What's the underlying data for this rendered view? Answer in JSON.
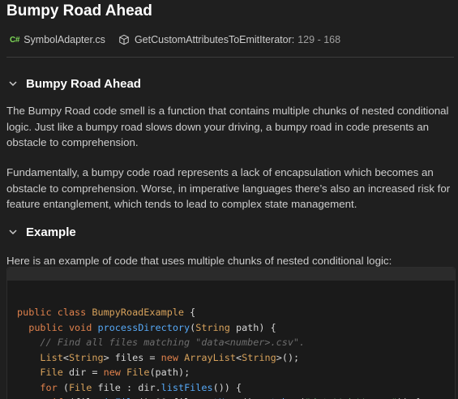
{
  "header": {
    "title": "Bumpy Road Ahead",
    "file_icon_text": "C#",
    "file_name": "SymbolAdapter.cs",
    "method_name": "GetCustomAttributesToEmitIterator:",
    "line_range": "129 - 168"
  },
  "sections": [
    {
      "heading": "Bumpy Road Ahead",
      "paragraphs": [
        "The Bumpy Road code smell is a function that contains multiple chunks of nested conditional logic. Just like a bumpy road slows down your driving, a bumpy road in code presents an obstacle to comprehension.",
        "Fundamentally, a bumpy code road represents a lack of encapsulation which becomes an obstacle to comprehension. Worse, in imperative languages there’s also an increased risk for feature entanglement, which tends to lead to complex state management."
      ]
    },
    {
      "heading": "Example",
      "paragraphs": [
        "Here is an example of code that uses multiple chunks of nested conditional logic:"
      ]
    }
  ],
  "code_example": {
    "language": "java",
    "lines": [
      "public class BumpyRoadExample {",
      "  public void processDirectory(String path) {",
      "    // Find all files matching \"data<number>.csv\".",
      "    List<String> files = new ArrayList<String>();",
      "    File dir = new File(path);",
      "    for (File file : dir.listFiles()) {",
      "      if (file.isFile() && file.getName().matches(\"data\\\\d+\\\\.csv\")) {"
    ]
  },
  "colors": {
    "background": "#1f1f1f",
    "keyword": "#e0814c",
    "type": "#d6a15b",
    "function": "#56a8f5",
    "comment": "#6d6d6d",
    "string": "#6aab73",
    "csharp_icon": "#7ed957"
  }
}
